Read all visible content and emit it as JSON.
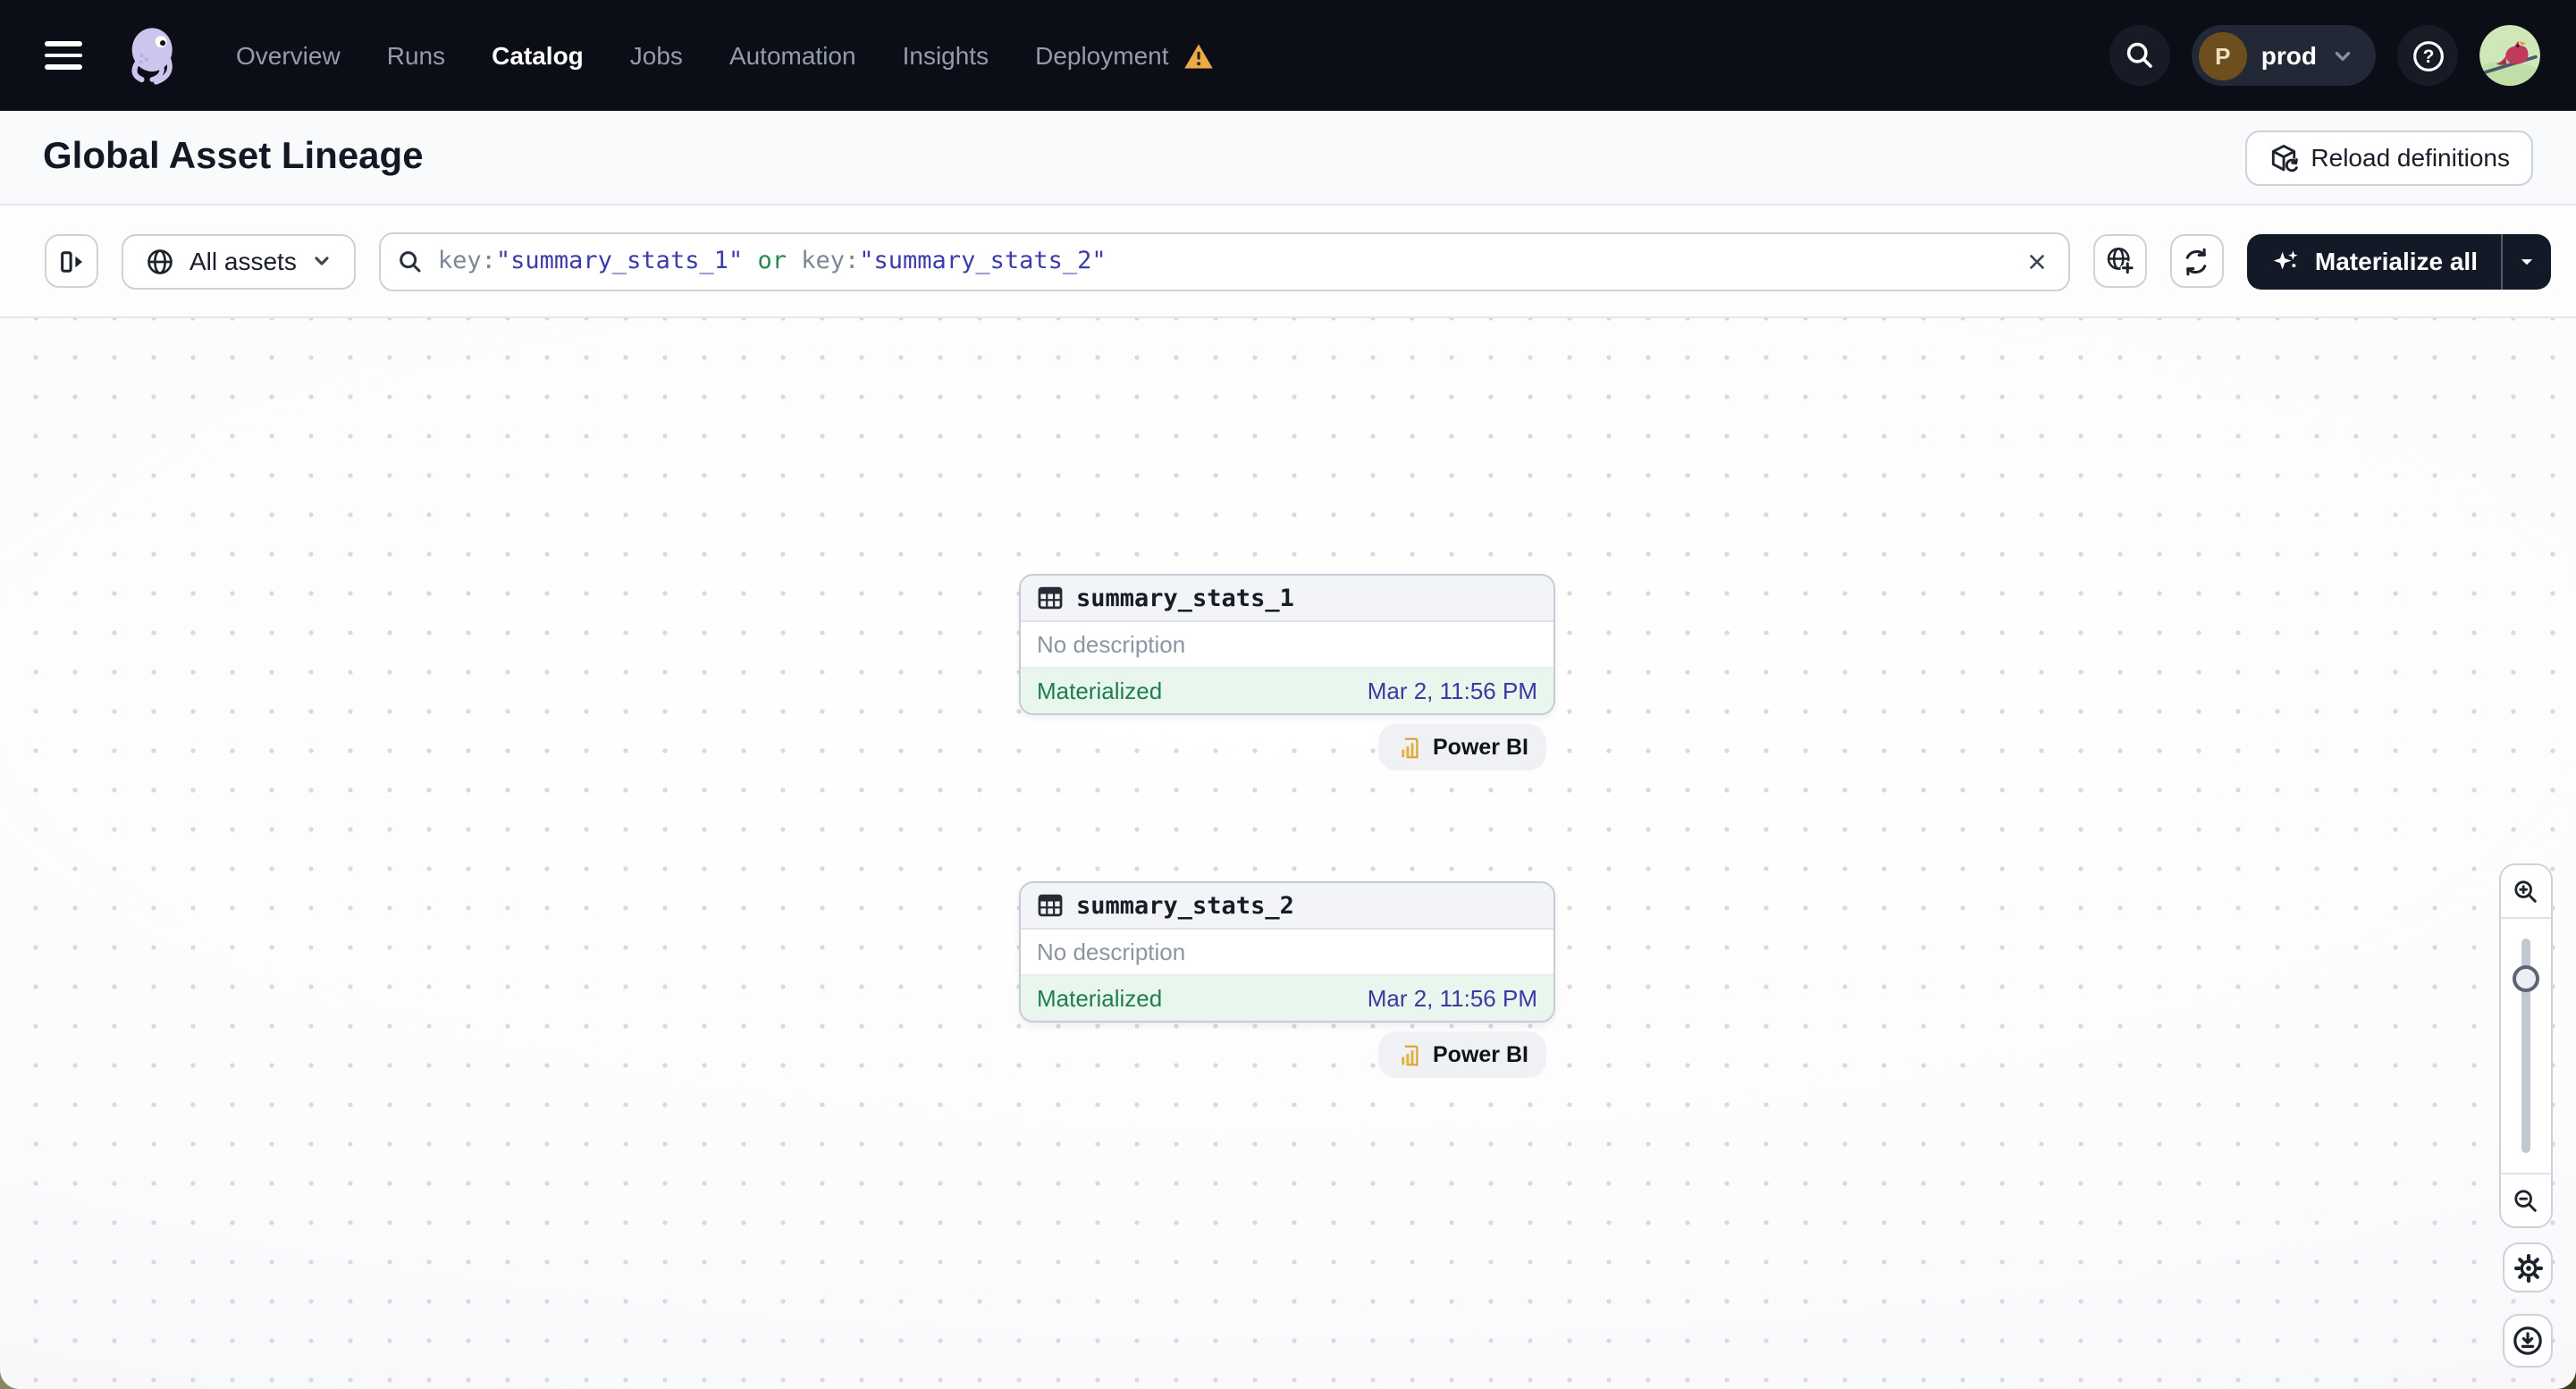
{
  "nav": {
    "items": [
      "Overview",
      "Runs",
      "Catalog",
      "Jobs",
      "Automation",
      "Insights",
      "Deployment"
    ],
    "active_item": "Catalog",
    "deployment_has_warning": true,
    "environment": {
      "initial": "P",
      "name": "prod"
    }
  },
  "page_header": {
    "title": "Global Asset Lineage",
    "reload_button_label": "Reload definitions"
  },
  "toolbar": {
    "asset_scope_label": "All assets",
    "search_query_full": "key:\"summary_stats_1\" or key:\"summary_stats_2\"",
    "search_query_segments": [
      {
        "text": "key:",
        "role": "key"
      },
      {
        "text": "\"summary_stats_1\"",
        "role": "value"
      },
      {
        "text": " or ",
        "role": "operator"
      },
      {
        "text": "key:",
        "role": "key"
      },
      {
        "text": "\"summary_stats_2\"",
        "role": "value"
      }
    ],
    "materialize_button_label": "Materialize all"
  },
  "lineage_graph": {
    "nodes": [
      {
        "name": "summary_stats_1",
        "description": "No description",
        "status": "Materialized",
        "last_materialization": "Mar 2, 11:56 PM",
        "downstream_tag": "Power BI"
      },
      {
        "name": "summary_stats_2",
        "description": "No description",
        "status": "Materialized",
        "last_materialization": "Mar 2, 11:56 PM",
        "downstream_tag": "Power BI"
      }
    ]
  },
  "colors": {
    "nav_background": "#0b0e16",
    "warning_amber": "#ecaa44",
    "materialized_green": "#1e7e4f",
    "materialized_row_bg": "#e8f6ee",
    "timestamp_indigo": "#3a3aa3",
    "query_value_indigo": "#3c3cab",
    "query_operator_green": "#268a4e",
    "materialize_button_bg": "#141927",
    "powerbi_yellow": "#e2b13a"
  }
}
